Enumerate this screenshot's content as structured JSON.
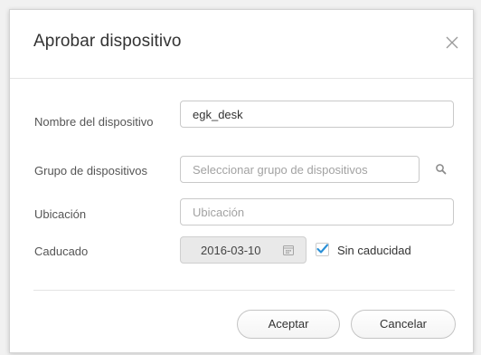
{
  "dialog": {
    "title": "Aprobar dispositivo",
    "close_icon": "close-icon"
  },
  "form": {
    "device_name": {
      "label": "Nombre del dispositivo",
      "value": "egk_desk"
    },
    "device_group": {
      "label": "Grupo de dispositivos",
      "placeholder": "Seleccionar grupo de dispositivos",
      "icon": "search-icon"
    },
    "location": {
      "label": "Ubicación",
      "placeholder": "Ubicación"
    },
    "expiry": {
      "label": "Caducado",
      "date": "2016-03-10",
      "date_disabled": true,
      "icon": "calendar-icon",
      "no_expiry_label": "Sin caducidad",
      "no_expiry_checked": true
    }
  },
  "buttons": {
    "accept_label": "Aceptar",
    "cancel_label": "Cancelar"
  },
  "colors": {
    "check_accent": "#2a8fd6",
    "disabled_field_bg": "#e9e9e9"
  }
}
